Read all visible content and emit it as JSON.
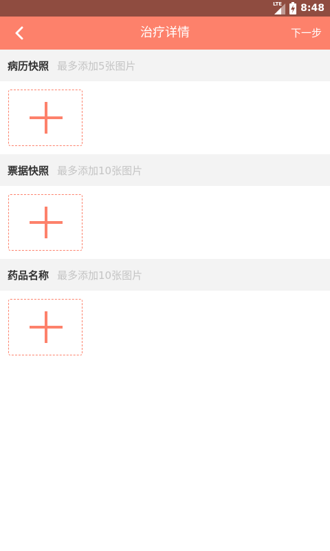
{
  "status_bar": {
    "network": "LTE",
    "time": "8:48"
  },
  "app_bar": {
    "title": "治疗详情",
    "next_label": "下一步",
    "back_icon": "chevron-left-icon"
  },
  "colors": {
    "status_bar": "#8f4c40",
    "accent": "#fd816b",
    "section_bg": "#f3f3f3",
    "title_text": "#333333",
    "hint_text": "#c4c4c4"
  },
  "sections": [
    {
      "title": "病历快照",
      "hint": "最多添加5张图片",
      "add_icon": "plus-icon"
    },
    {
      "title": "票据快照",
      "hint": "最多添加10张图片",
      "add_icon": "plus-icon"
    },
    {
      "title": "药品名称",
      "hint": "最多添加10张图片",
      "add_icon": "plus-icon"
    }
  ]
}
